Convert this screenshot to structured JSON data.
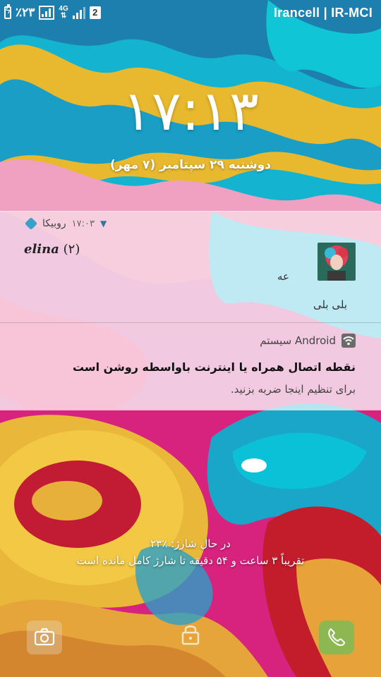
{
  "status_bar": {
    "battery_percent": "٪۲۳",
    "network_type": "4G",
    "sim_slot": "2",
    "carrier": "Irancell | IR-MCI",
    "icons": [
      "battery-charging-icon",
      "signal-box-icon",
      "signal-bars-icon",
      "sim-icon"
    ]
  },
  "lockscreen": {
    "time": "۱۷:۱۳",
    "date": "دوشنبه ۲۹ سپتامبر (۷ مهر)"
  },
  "notifications": [
    {
      "app_name": "روبیکا",
      "time": "۱۷:۰۳",
      "sender_name": "elina",
      "unread_count": "(۲)",
      "messages": [
        "عه",
        "بلی بلی"
      ],
      "icon": "rubika-icon"
    },
    {
      "app_name": "سیستم Android",
      "title": "نقطه اتصال همراه یا اینترنت باواسطه روشن است",
      "text": "برای تنظیم اینجا ضربه بزنید.",
      "icon": "wifi-hotspot-icon"
    }
  ],
  "charging": {
    "status": "در حال شارژ: ٪۲۳",
    "estimate": "تقریباً ۳ ساعت و ۵۴ دقیقه تا شارژ کامل مانده است"
  },
  "shortcuts": {
    "left": "camera-icon",
    "center": "lock-icon",
    "right": "phone-icon"
  },
  "colors": {
    "overlay": "#ffffff",
    "phone_button": "#6ebe5a",
    "rubika_accent": "#3aa0c9"
  }
}
